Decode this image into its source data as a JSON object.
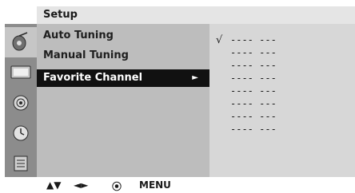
{
  "header": {
    "title": "Setup"
  },
  "sidebar": {
    "icons": [
      {
        "name": "tuning-icon",
        "active": true
      },
      {
        "name": "picture-icon",
        "active": false
      },
      {
        "name": "sound-icon",
        "active": false
      },
      {
        "name": "time-icon",
        "active": false
      },
      {
        "name": "special-icon",
        "active": false
      }
    ]
  },
  "menu": {
    "items": [
      {
        "label": "Auto Tuning",
        "selected": false
      },
      {
        "label": "Manual Tuning",
        "selected": false
      },
      {
        "label": "Favorite Channel",
        "selected": true,
        "arrow": "►"
      }
    ]
  },
  "channel_list": {
    "check_mark": "√",
    "slots": [
      "---- ---",
      "---- ---",
      "---- ---",
      "---- ---",
      "---- ---",
      "---- ---",
      "---- ---",
      "---- ---"
    ]
  },
  "footer": {
    "updown": "▲▼",
    "leftright": "◄►",
    "ok_symbol": "⦿",
    "menu_label": "MENU"
  },
  "colors": {
    "header_bg": "#e5e5e5",
    "icon_col_bg": "#8c8c8c",
    "menu_bg": "#bdbdbd",
    "selected_bg": "#111111",
    "list_bg": "#d7d7d7"
  }
}
